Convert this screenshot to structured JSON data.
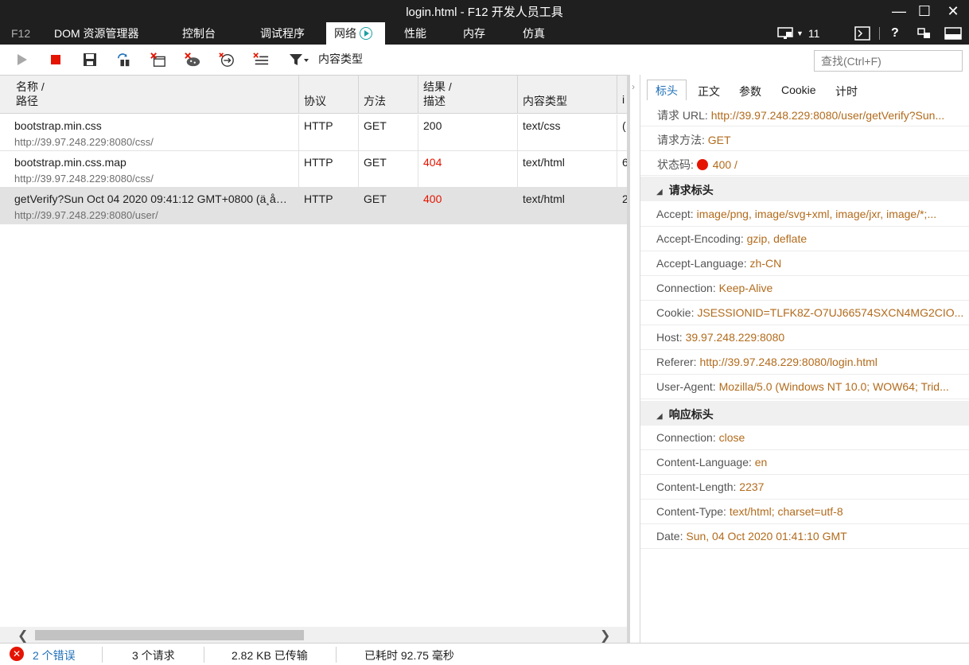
{
  "window": {
    "title": "login.html - F12 开发人员工具",
    "minimize": "—",
    "maximize": "☐",
    "close": "✕"
  },
  "tabs": {
    "f12": "F12",
    "items": [
      "DOM 资源管理器",
      "控制台",
      "调试程序",
      "网络",
      "性能",
      "内存",
      "仿真"
    ],
    "active": "网络",
    "emulation_count": "11"
  },
  "toolbar": {
    "filter_label": "内容类型",
    "search_placeholder": "查找(Ctrl+F)"
  },
  "grid": {
    "headers": {
      "name_line1": "名称 /",
      "name_line2": "路径",
      "protocol": "协议",
      "method": "方法",
      "result_line1": "结果 /",
      "result_line2": "描述",
      "content_type": "内容类型",
      "next": "i"
    },
    "rows": [
      {
        "name": "bootstrap.min.css",
        "path": "http://39.97.248.229:8080/css/",
        "protocol": "HTTP",
        "method": "GET",
        "result": "200",
        "result_error": false,
        "type": "text/css",
        "next": "("
      },
      {
        "name": "bootstrap.min.css.map",
        "path": "http://39.97.248.229:8080/css/",
        "protocol": "HTTP",
        "method": "GET",
        "result": "404",
        "result_error": true,
        "type": "text/html",
        "next": "6"
      },
      {
        "name": "getVerify?Sun Oct 04 2020 09:41:12 GMT+0800 (ä¸å…...",
        "path": "http://39.97.248.229:8080/user/",
        "protocol": "HTTP",
        "method": "GET",
        "result": "400",
        "result_error": true,
        "type": "text/html",
        "next": "2"
      }
    ]
  },
  "details": {
    "tabs": [
      "标头",
      "正文",
      "参数",
      "Cookie",
      "计时"
    ],
    "active_tab": "标头",
    "general": [
      {
        "label": "请求 URL: ",
        "value": "http://39.97.248.229:8080/user/getVerify?Sun..."
      },
      {
        "label": "请求方法: ",
        "value": "GET"
      }
    ],
    "status_label": "状态码: ",
    "status_value": "400 /",
    "request_section": "请求标头",
    "request_headers": [
      {
        "label": "Accept: ",
        "value": "image/png, image/svg+xml, image/jxr, image/*;..."
      },
      {
        "label": "Accept-Encoding: ",
        "value": "gzip, deflate"
      },
      {
        "label": "Accept-Language: ",
        "value": "zh-CN"
      },
      {
        "label": "Connection: ",
        "value": "Keep-Alive"
      },
      {
        "label": "Cookie: ",
        "value": "JSESSIONID=TLFK8Z-O7UJ66574SXCN4MG2CIO..."
      },
      {
        "label": "Host: ",
        "value": "39.97.248.229:8080"
      },
      {
        "label": "Referer: ",
        "value": "http://39.97.248.229:8080/login.html"
      },
      {
        "label": "User-Agent: ",
        "value": "Mozilla/5.0 (Windows NT 10.0; WOW64; Trid..."
      }
    ],
    "response_section": "响应标头",
    "response_headers": [
      {
        "label": "Connection: ",
        "value": "close"
      },
      {
        "label": "Content-Language: ",
        "value": "en"
      },
      {
        "label": "Content-Length: ",
        "value": "2237"
      },
      {
        "label": "Content-Type: ",
        "value": "text/html; charset=utf-8"
      },
      {
        "label": "Date: ",
        "value": "Sun, 04 Oct 2020 01:41:10 GMT"
      }
    ]
  },
  "statusbar": {
    "errors": "2 个错误",
    "requests": "3 个请求",
    "transferred": "2.82 KB 已传输",
    "elapsed": "已耗时 92.75 毫秒"
  },
  "colors": {
    "accent": "#1e6fb7",
    "error": "#e51400",
    "value": "#b26b1c",
    "chrome": "#1f1f1f"
  }
}
